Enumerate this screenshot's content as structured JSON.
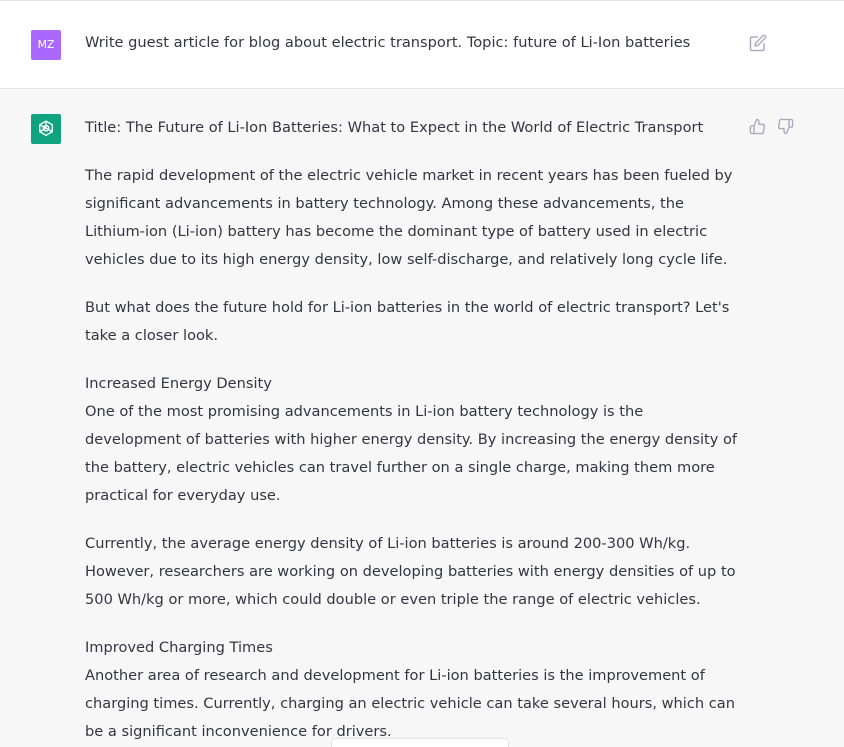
{
  "user_message": {
    "avatar_initials": "MZ",
    "text": "Write guest article for blog about electric transport. Topic: future of Li-Ion batteries"
  },
  "assistant_message": {
    "title": "Title: The Future of Li-Ion Batteries: What to Expect in the World of Electric Transport",
    "paragraphs": [
      "The rapid development of the electric vehicle market in recent years has been fueled by significant advancements in battery technology. Among these advancements, the Lithium-ion (Li-ion) battery has become the dominant type of battery used in electric vehicles due to its high energy density, low self-discharge, and relatively long cycle life.",
      "But what does the future hold for Li-ion batteries in the world of electric transport? Let's take a closer look."
    ],
    "sections": [
      {
        "heading": "Increased Energy Density",
        "paragraphs": [
          "One of the most promising advancements in Li-ion battery technology is the development of batteries with higher energy density. By increasing the energy density of the battery, electric vehicles can travel further on a single charge, making them more practical for everyday use.",
          "Currently, the average energy density of Li-ion batteries is around 200-300 Wh/kg. However, researchers are working on developing batteries with energy densities of up to 500 Wh/kg or more, which could double or even triple the range of electric vehicles."
        ]
      },
      {
        "heading": "Improved Charging Times",
        "paragraphs": [
          "Another area of research and development for Li-ion batteries is the improvement of charging times. Currently, charging an electric vehicle can take several hours, which can be a significant inconvenience for drivers."
        ]
      }
    ]
  },
  "icons": {
    "edit": "edit-icon",
    "thumb_up": "thumbs-up-icon",
    "thumb_down": "thumbs-down-icon",
    "bot_logo": "openai-logo-icon"
  },
  "colors": {
    "user_avatar": "#ab68ff",
    "bot_avatar": "#10a37f",
    "assistant_bg": "#f7f7f8",
    "user_bg": "#ffffff",
    "text": "#343541",
    "icon": "#acacbe"
  }
}
